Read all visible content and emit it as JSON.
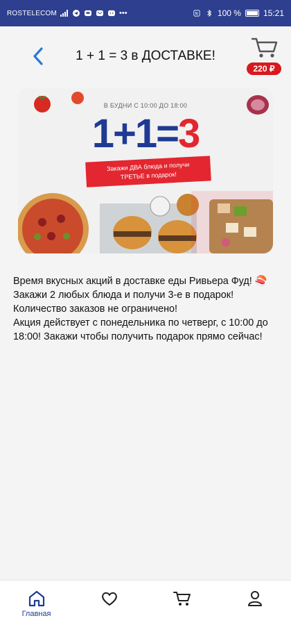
{
  "status_bar": {
    "carrier": "ROSTELECOM",
    "battery": "100 %",
    "time": "15:21"
  },
  "header": {
    "title": "1 + 1 = 3 в ДОСТАВКЕ!",
    "cart_price": "220 ₽"
  },
  "banner": {
    "small_text": "В БУДНИ С 10:00 ДО 18:00",
    "big_left": "1+1=",
    "big_right": "3",
    "ribbon_line1": "Закажи ДВА блюда и получи",
    "ribbon_line2": "ТРЕТЬЕ в подарок!"
  },
  "description": {
    "lines": [
      "Время вкусных акций в доставке еды Ривьера Фуд! 🍣",
      "Закажи 2 любых блюда и получи 3-е в подарок!",
      "Количество заказов не ограничено!",
      "Акция действует с понедельника по четверг, с 10:00 до 18:00! Закажи чтобы получить подарок прямо сейчас!"
    ]
  },
  "nav": {
    "home_label": "Главная"
  },
  "colors": {
    "status_bar": "#2d3f8e",
    "accent_red": "#d71920",
    "accent_blue": "#1f3a93"
  }
}
